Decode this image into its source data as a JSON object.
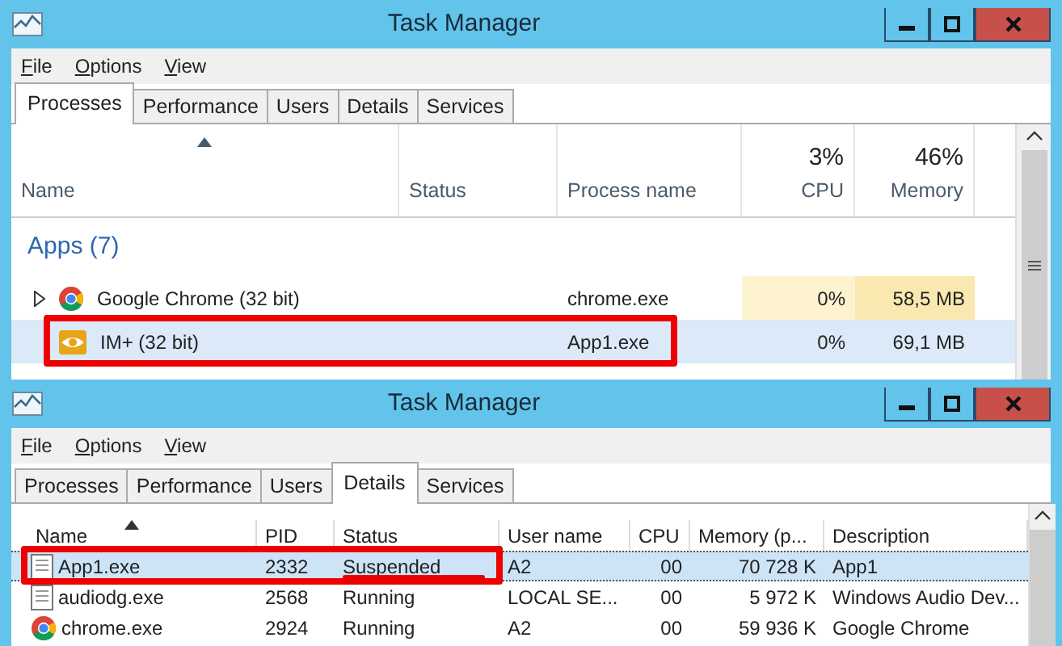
{
  "windows": [
    {
      "kind": "processes",
      "title": "Task Manager",
      "menu": [
        "File",
        "Options",
        "View"
      ],
      "tabs": [
        {
          "label": "Processes",
          "selected": true
        },
        {
          "label": "Performance",
          "selected": false
        },
        {
          "label": "Users",
          "selected": false
        },
        {
          "label": "Details",
          "selected": false
        },
        {
          "label": "Services",
          "selected": false
        }
      ],
      "columns": [
        {
          "label": "Name",
          "sorted": true
        },
        {
          "label": "Status",
          "sorted": false
        },
        {
          "label": "Process name",
          "sorted": false
        },
        {
          "label": "CPU",
          "summary": "3%",
          "sorted": false
        },
        {
          "label": "Memory",
          "summary": "46%",
          "sorted": false
        }
      ],
      "group": "Apps (7)",
      "rows": [
        {
          "expandable": true,
          "selected": false,
          "circled": false,
          "cells": [
            "Google Chrome (32 bit)",
            "",
            "chrome.exe",
            "0%",
            "58,5 MB"
          ]
        },
        {
          "expandable": false,
          "selected": true,
          "circled": true,
          "cells": [
            "IM+ (32 bit)",
            "",
            "App1.exe",
            "0%",
            "69,1 MB"
          ]
        }
      ]
    },
    {
      "kind": "details",
      "title": "Task Manager",
      "menu": [
        "File",
        "Options",
        "View"
      ],
      "tabs": [
        {
          "label": "Processes",
          "selected": false
        },
        {
          "label": "Performance",
          "selected": false
        },
        {
          "label": "Users",
          "selected": false
        },
        {
          "label": "Details",
          "selected": true
        },
        {
          "label": "Services",
          "selected": false
        }
      ],
      "columns": [
        {
          "label": "Name",
          "sorted": true
        },
        {
          "label": "PID",
          "sorted": false
        },
        {
          "label": "Status",
          "sorted": false
        },
        {
          "label": "User name",
          "sorted": false
        },
        {
          "label": "CPU",
          "sorted": false
        },
        {
          "label": "Memory (p...",
          "sorted": false
        },
        {
          "label": "Description",
          "sorted": false
        }
      ],
      "rows": [
        {
          "selected": true,
          "circled": true,
          "status_underlined": true,
          "cells": [
            "App1.exe",
            "2332",
            "Suspended",
            "A2",
            "00",
            "70 728 K",
            "App1"
          ]
        },
        {
          "selected": false,
          "circled": false,
          "status_underlined": false,
          "cells": [
            "audiodg.exe",
            "2568",
            "Running",
            "LOCAL SE...",
            "00",
            "5 972 K",
            "Windows Audio Dev..."
          ]
        },
        {
          "selected": false,
          "circled": false,
          "status_underlined": false,
          "cells": [
            "chrome.exe",
            "2924",
            "Running",
            "A2",
            "00",
            "59 936 K",
            "Google Chrome"
          ]
        }
      ]
    }
  ]
}
